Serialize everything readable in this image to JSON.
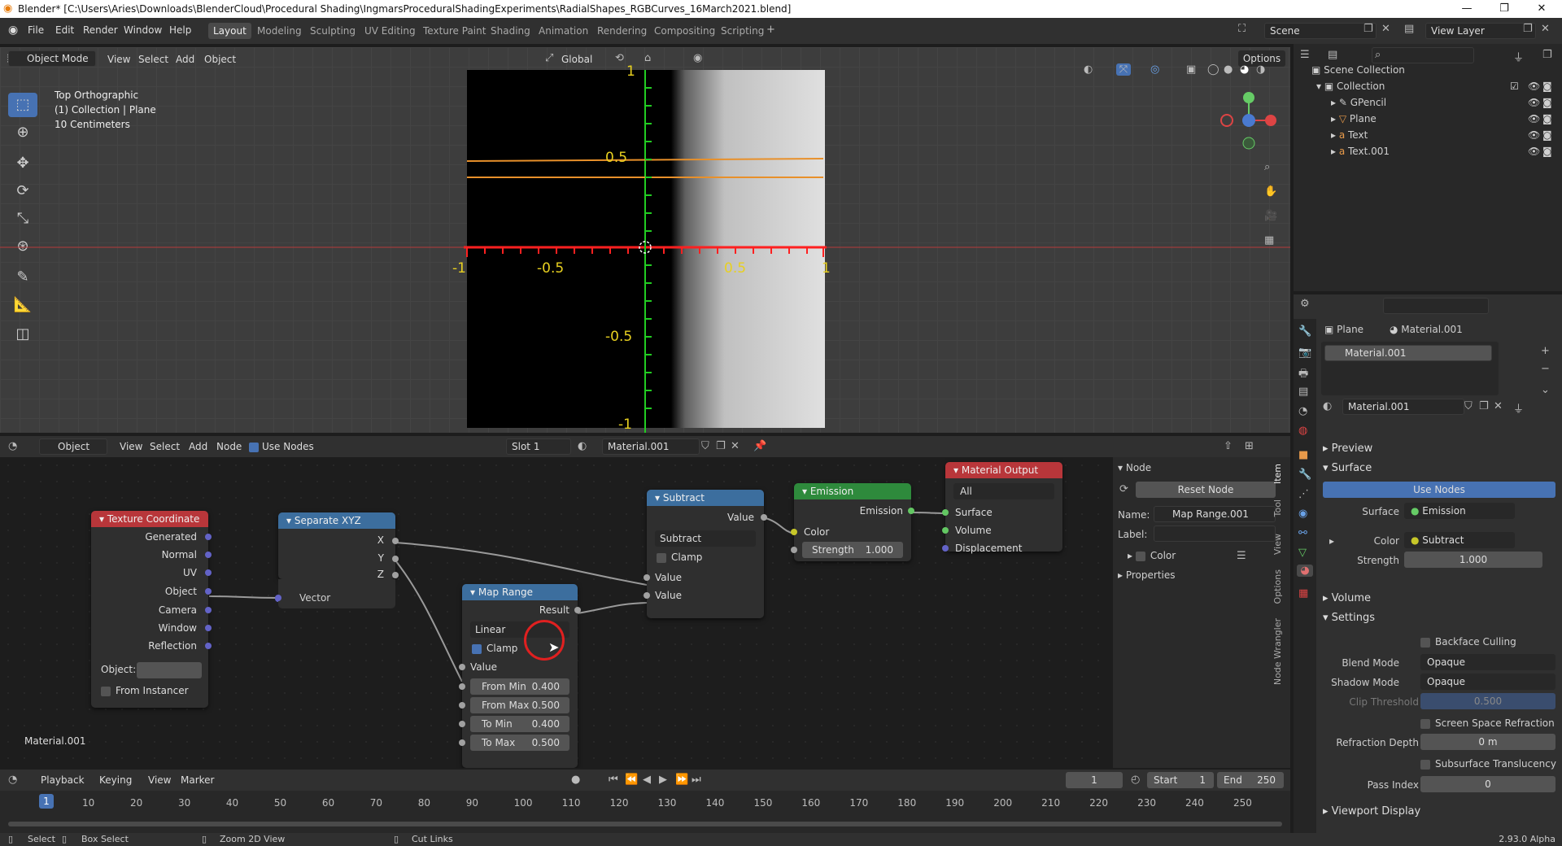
{
  "titlebar": {
    "title": "Blender* [C:\\Users\\Aries\\Downloads\\BlenderCloud\\Procedural Shading\\IngmarsProceduralShadingExperiments\\RadialShapes_RGBCurves_16March2021.blend]",
    "minimize": "—",
    "maximize": "❐",
    "close": "✕"
  },
  "menu": [
    "File",
    "Edit",
    "Render",
    "Window",
    "Help"
  ],
  "workspaces": [
    "Layout",
    "Modeling",
    "Sculpting",
    "UV Editing",
    "Texture Paint",
    "Shading",
    "Animation",
    "Rendering",
    "Compositing",
    "Scripting"
  ],
  "active_workspace": "Layout",
  "scene": "Scene",
  "view_layer": "View Layer",
  "viewport": {
    "mode": "Object Mode",
    "menu": [
      "View",
      "Select",
      "Add",
      "Object"
    ],
    "orientation": "Global",
    "options": "Options",
    "overlay_lines": [
      "Top Orthographic",
      "(1) Collection | Plane",
      "10 Centimeters"
    ],
    "axis_labels_x": [
      "-1",
      "-0.5",
      "0.5",
      "1"
    ],
    "axis_labels_y": [
      "1",
      "0.5",
      "-0.5",
      "-1"
    ]
  },
  "outliner": {
    "root": "Scene Collection",
    "collection": "Collection",
    "items": [
      "GPencil",
      "Plane",
      "Text",
      "Text.001"
    ]
  },
  "properties": {
    "object": "Plane",
    "material": "Material.001",
    "slot": "Material.001",
    "material_field": "Material.001",
    "sections": {
      "preview": "Preview",
      "surface": "Surface",
      "use_nodes": "Use Nodes",
      "surface_label": "Surface",
      "surface_value": "Emission",
      "color_label": "Color",
      "color_value": "Subtract",
      "strength_label": "Strength",
      "strength_value": "1.000",
      "volume": "Volume",
      "settings": "Settings",
      "backface": "Backface Culling",
      "blend_label": "Blend Mode",
      "blend_value": "Opaque",
      "shadow_label": "Shadow Mode",
      "shadow_value": "Opaque",
      "clip_label": "Clip Threshold",
      "clip_value": "0.500",
      "ssr": "Screen Space Refraction",
      "refr_label": "Refraction Depth",
      "refr_value": "0 m",
      "sss": "Subsurface Translucency",
      "pass_label": "Pass Index",
      "pass_value": "0",
      "viewport_display": "Viewport Display"
    }
  },
  "node_editor": {
    "header": {
      "type": "Object",
      "menu": [
        "View",
        "Select",
        "Add",
        "Node"
      ],
      "use_nodes": "Use Nodes",
      "slot": "Slot 1",
      "material": "Material.001"
    },
    "material_label": "Material.001",
    "texcoord": {
      "title": "Texture Coordinate",
      "outputs": [
        "Generated",
        "Normal",
        "UV",
        "Object",
        "Camera",
        "Window",
        "Reflection"
      ],
      "object_label": "Object:",
      "from_instancer": "From Instancer"
    },
    "sepxyz": {
      "title": "Separate XYZ",
      "outputs": [
        "X",
        "Y",
        "Z"
      ],
      "input": "Vector"
    },
    "maprange": {
      "title": "Map Range",
      "output": "Result",
      "interp": "Linear",
      "clamp": "Clamp",
      "value": "Value",
      "fields": [
        {
          "label": "From Min",
          "value": "0.400"
        },
        {
          "label": "From Max",
          "value": "0.500"
        },
        {
          "label": "To Min",
          "value": "0.400"
        },
        {
          "label": "To Max",
          "value": "0.500"
        }
      ]
    },
    "subtract": {
      "title": "Subtract",
      "output": "Value",
      "op": "Subtract",
      "clamp": "Clamp",
      "in1": "Value",
      "in2": "Value"
    },
    "emission": {
      "title": "Emission",
      "output": "Emission",
      "color": "Color",
      "strength_label": "Strength",
      "strength": "1.000"
    },
    "matout": {
      "title": "Material Output",
      "target": "All",
      "inputs": [
        "Surface",
        "Volume",
        "Displacement"
      ]
    },
    "npanel": {
      "node": "Node",
      "reset": "Reset Node",
      "name_label": "Name:",
      "name": "Map Range.001",
      "label_label": "Label:",
      "color": "Color",
      "properties": "Properties"
    },
    "tabs": [
      "Item",
      "Tool",
      "View",
      "Options",
      "Node Wrangler"
    ]
  },
  "timeline": {
    "menu": [
      "Playback",
      "Keying",
      "View",
      "Marker"
    ],
    "current": "1",
    "start_label": "Start",
    "start": "1",
    "end_label": "End",
    "end": "250",
    "ticks": [
      "1",
      "10",
      "20",
      "30",
      "40",
      "50",
      "60",
      "70",
      "80",
      "90",
      "100",
      "110",
      "120",
      "130",
      "140",
      "150",
      "160",
      "170",
      "180",
      "190",
      "200",
      "210",
      "220",
      "230",
      "240",
      "250"
    ]
  },
  "status": {
    "select": "Select",
    "box": "Box Select",
    "zoom": "Zoom 2D View",
    "cut": "Cut Links",
    "version": "2.93.0 Alpha"
  },
  "colors": {
    "accent": "#4772b3",
    "texcoord": "#b8363a",
    "sepxyz": "#3c6e9e",
    "maprange": "#3c6e9e",
    "subtract": "#3c6e9e",
    "emission": "#2e8a3c",
    "matout": "#b8363a"
  }
}
